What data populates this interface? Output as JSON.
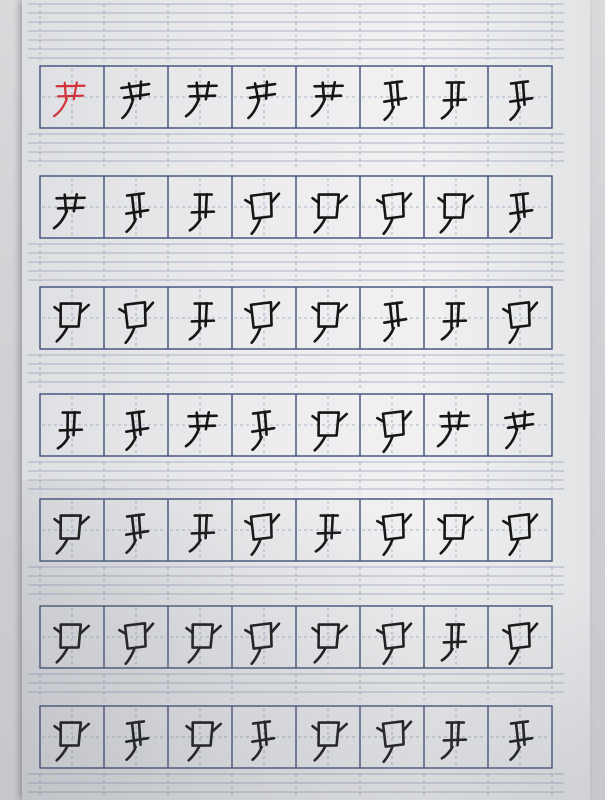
{
  "worksheet": {
    "rows": 7,
    "columns": 8,
    "model_character_color": "#d2333b",
    "pencil_color": "#161616",
    "grid_color": "#3d4e78"
  }
}
